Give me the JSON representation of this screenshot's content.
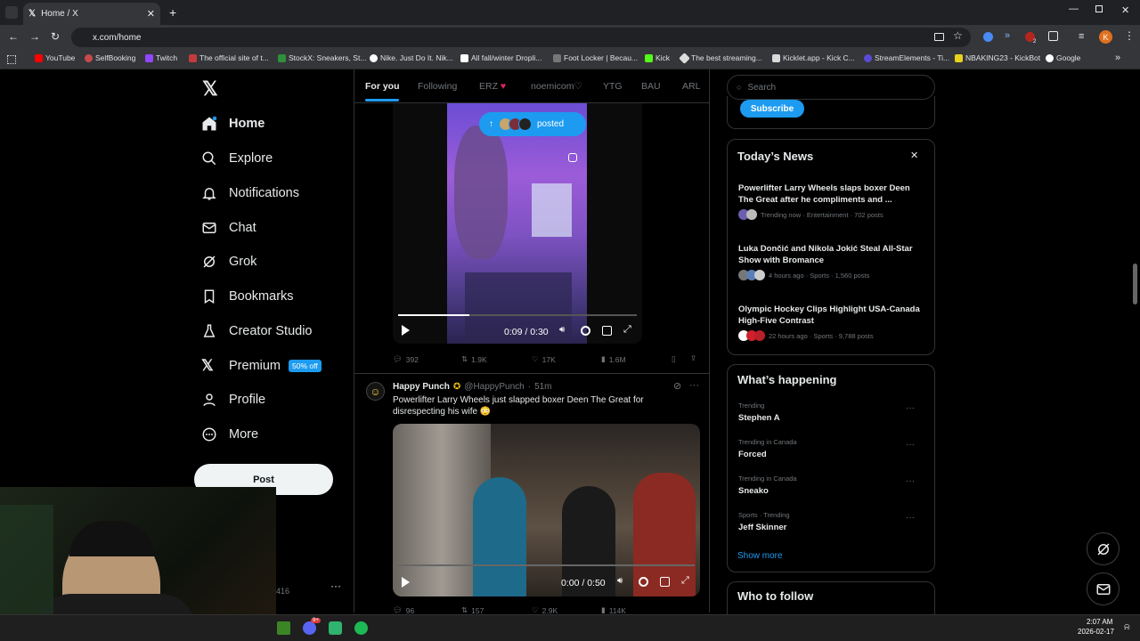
{
  "browser": {
    "tab_title": "Home / X",
    "url": "x.com/home",
    "profile_initial": "K",
    "bookmarks": [
      "YouTube",
      "SelfBooking",
      "Twitch",
      "The official site of t...",
      "StockX: Sneakers, St...",
      "Nike. Just Do It. Nik...",
      "All fall/winter Dropli...",
      "Foot Locker | Becau...",
      "Kick",
      "The best streaming...",
      "Kicklet.app - Kick C...",
      "StreamElements - Ti...",
      "NBAKING23 - KickBot",
      "Google"
    ],
    "ext_badge": "2"
  },
  "nav": {
    "items": [
      "Home",
      "Explore",
      "Notifications",
      "Chat",
      "Grok",
      "Bookmarks",
      "Creator Studio",
      "Premium",
      "Profile",
      "More"
    ],
    "premium_badge": "50% off",
    "post_label": "Post",
    "account_partial": "416"
  },
  "timeline": {
    "tabs": [
      "For you",
      "Following",
      "ERZ",
      "noemicom",
      "YTG",
      "BAU",
      "ARL"
    ],
    "posted_pill": "posted",
    "post1": {
      "video_time": "0:09 / 0:30",
      "progress": 0.3,
      "replies": "392",
      "reposts": "1.9K",
      "likes": "17K",
      "views": "1.6M"
    },
    "post2": {
      "name": "Happy Punch",
      "handle": "@HappyPunch",
      "age": "51m",
      "text": "Powerlifter Larry Wheels just slapped boxer Deen The Great for disrespecting his wife 😳",
      "video_time": "0:00 / 0:50",
      "replies": "96",
      "reposts": "157",
      "likes": "2.9K",
      "views": "114K"
    }
  },
  "right": {
    "search_placeholder": "Search",
    "subscribe_label": "Subscribe",
    "news_title": "Today’s News",
    "news": [
      {
        "title": "Powerlifter Larry Wheels slaps boxer Deen The Great after he compliments and ...",
        "meta": "Trending now · Entertainment · 702 posts"
      },
      {
        "title": "Luka Dončić and Nikola Jokić Steal All-Star Show with Bromance",
        "meta": "4 hours ago · Sports · 1,560 posts"
      },
      {
        "title": "Olympic Hockey Clips Highlight USA-Canada High-Five Contrast",
        "meta": "22 hours ago · Sports · 9,788 posts"
      }
    ],
    "happening_title": "What’s happening",
    "trends": [
      {
        "context": "Trending",
        "name": "Stephen A"
      },
      {
        "context": "Trending in Canada",
        "name": "Forced"
      },
      {
        "context": "Trending in Canada",
        "name": "Sneako"
      },
      {
        "context": "Sports · Trending",
        "name": "Jeff Skinner"
      }
    ],
    "show_more": "Show more",
    "who_to_follow": "Who to follow"
  },
  "taskbar": {
    "time": "2:07 AM",
    "date": "2026-02-17",
    "discord_badge": "9+"
  },
  "colors": {
    "accent": "#1d9bf0",
    "bg": "#000000",
    "border": "#2f3336",
    "muted": "#71767b"
  }
}
